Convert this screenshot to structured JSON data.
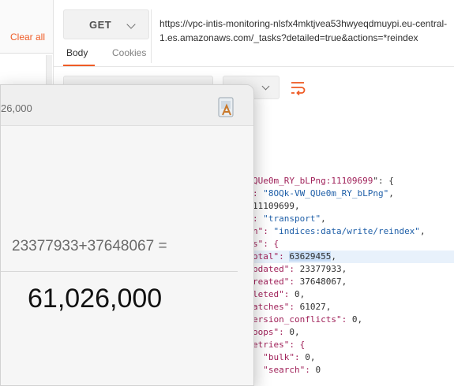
{
  "sidebar": {
    "clear_all_label": "Clear all"
  },
  "request": {
    "method": "GET",
    "url": "https://vpc-intis-monitoring-nlsfx4mktjvea53hwyeqdmuypi.eu-central-1.es.amazonaws.com/_tasks?detailed=true&actions=*reindex"
  },
  "tabs": {
    "body": "Body",
    "cookies": "Cookies"
  },
  "toolbar": {
    "wrap_icon": "wrap-lines-icon"
  },
  "response_lines": [
    {
      "pre": "",
      "key": "QUe0m_RY_bLPng:11109699",
      "post": "\": {"
    },
    {
      "pre": ": ",
      "val": "\"8OQk-VW_QUe0m_RY_bLPng\"",
      "post": ","
    },
    {
      "pre": "",
      "num": "11109699",
      "post": ","
    },
    {
      "pre": ": ",
      "val": "\"transport\"",
      "post": ","
    },
    {
      "pre": "n\": ",
      "val": "\"indices:data/write/reindex\"",
      "post": ","
    },
    {
      "pre": "s\": {",
      "post": ""
    },
    {
      "pre": "otal\": ",
      "num": "63629455",
      "post": ","
    },
    {
      "pre": "pdated\": ",
      "num": "23377933",
      "post": ","
    },
    {
      "pre": "reated\": ",
      "num": "37648067",
      "post": ","
    },
    {
      "pre": "leted\": ",
      "num": "0",
      "post": ","
    },
    {
      "pre": "atches\": ",
      "num": "61027",
      "post": ","
    },
    {
      "pre": "ersion_conflicts\": ",
      "num": "0",
      "post": ","
    },
    {
      "pre": "oops\": ",
      "num": "0",
      "post": ","
    },
    {
      "pre": "etries\": {",
      "post": ""
    },
    {
      "pre": "  \"bulk\": ",
      "num": "0",
      "post": ","
    },
    {
      "pre": "  \"search\": ",
      "num": "0",
      "post": ""
    }
  ],
  "calculator": {
    "header_value": "26,000",
    "expression": "23377933+37648067 =",
    "result": "61,026,000",
    "icon": "app-icon"
  },
  "colors": {
    "accent": "#ef5b25",
    "key": "#a0225a",
    "string": "#1f5fa8"
  }
}
